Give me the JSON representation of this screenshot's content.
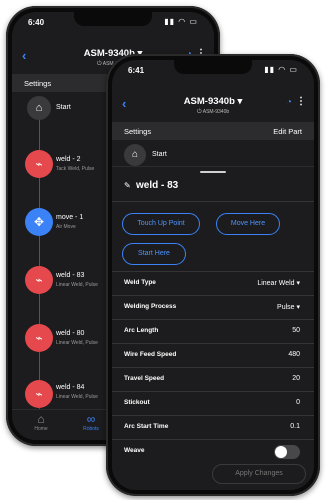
{
  "back_phone": {
    "status_time": "6:40",
    "header": {
      "title": "ASM-9340b ▾",
      "subtitle": "ASM-9340b"
    },
    "bar_label": "Settings",
    "nodes": [
      {
        "label": "Start",
        "sub": ""
      },
      {
        "label": "weld - 2",
        "sub": "Tack Weld, Pulse"
      },
      {
        "label": "move - 1",
        "sub": "Air Move"
      },
      {
        "label": "weld - 83",
        "sub": "Linear Weld, Pulse"
      },
      {
        "label": "weld - 80",
        "sub": "Linear Weld, Pulse"
      },
      {
        "label": "weld - 84",
        "sub": "Linear Weld, Pulse"
      }
    ],
    "tabbar": {
      "home": "Home",
      "robots": "Robots"
    }
  },
  "front_phone": {
    "status_time": "6:41",
    "header": {
      "title": "ASM-9340b ▾",
      "subtitle": "ASM-9340b"
    },
    "bar": {
      "left": "Settings",
      "right": "Edit Part"
    },
    "start_label": "Start",
    "detail_title": "weld - 83",
    "buttons": {
      "touch_up": "Touch Up Point",
      "move_here": "Move Here",
      "start_here": "Start Here"
    },
    "fields": [
      {
        "label": "Weld Type",
        "value": "Linear Weld ▾"
      },
      {
        "label": "Welding Process",
        "value": "Pulse ▾"
      },
      {
        "label": "Arc Length",
        "value": "50"
      },
      {
        "label": "Wire Feed Speed",
        "value": "480"
      },
      {
        "label": "Travel Speed",
        "value": "20"
      },
      {
        "label": "Stickout",
        "value": "0"
      },
      {
        "label": "Arc Start Time",
        "value": "0.1"
      }
    ],
    "weave_label": "Weave",
    "weave_on": false,
    "apply_label": "Apply Changes"
  },
  "icons": {
    "back": "‹",
    "home": "⌂",
    "history": "◔",
    "more": "⋮",
    "weld": "⌁",
    "move": "✥",
    "edit": "✎",
    "robot": "∞",
    "signal": "▮▮ ◠ ▭",
    "power": "⏻"
  },
  "colors": {
    "accent": "#3b82f6",
    "weld": "#e5484d",
    "move": "#3b82f6"
  }
}
